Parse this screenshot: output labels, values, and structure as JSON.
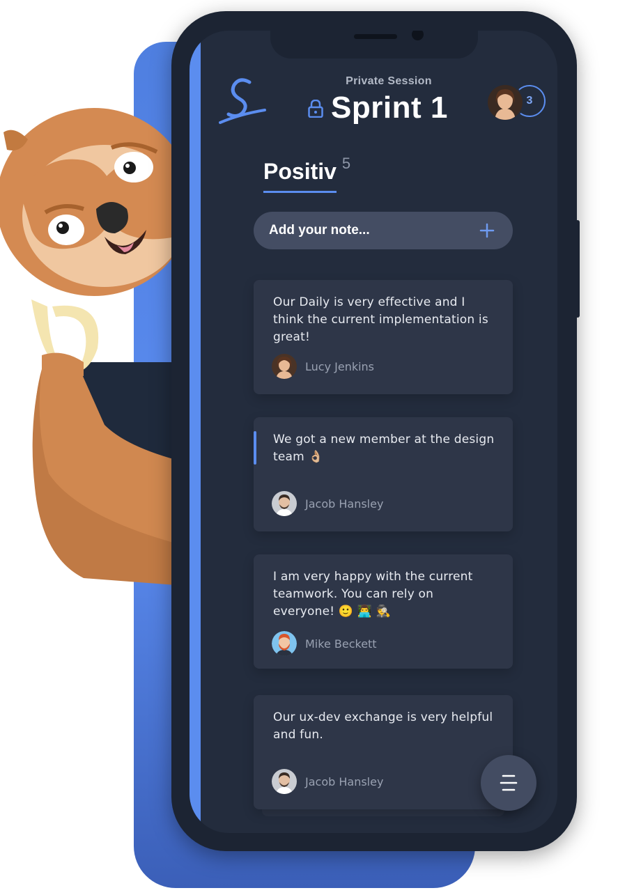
{
  "header": {
    "session_type": "Private Session",
    "session_title": "Sprint 1",
    "participant_count": "3",
    "logo_icon": "script-s-logo",
    "lock_icon": "lock-icon"
  },
  "column": {
    "title": "Positiv",
    "count": "5"
  },
  "add_note": {
    "label": "Add your note...",
    "icon": "plus-icon"
  },
  "notes": [
    {
      "text": "Our Daily is very effective and I think the current implementation is great!",
      "author": "Lucy Jenkins"
    },
    {
      "text": "We got a new member at the design team 👌🏼",
      "author": "Jacob Hansley"
    },
    {
      "text": "I am very happy with the current teamwork. You can rely on everyone! 🙂 👨‍💻 🕵️",
      "author": "Mike Beckett"
    },
    {
      "text": "Our ux-dev exchange is very helpful and fun.",
      "author": "Jacob Hansley"
    }
  ],
  "menu_button": {
    "icon": "menu-icon"
  },
  "colors": {
    "accent": "#5b8def",
    "screen_bg": "#232c3d",
    "card_bg": "#2e3648",
    "input_bg": "#444d63"
  }
}
